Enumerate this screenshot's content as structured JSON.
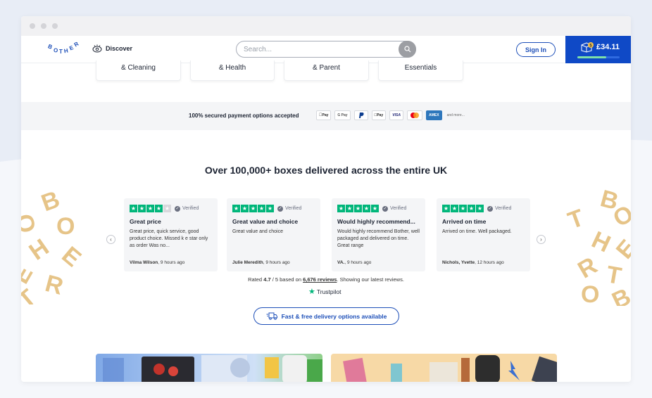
{
  "header": {
    "logo_text": "BOTHER",
    "discover_label": "Discover",
    "search_placeholder": "Search...",
    "signin_label": "Sign In",
    "cart_amount": "£34.11",
    "cart_badge": "5",
    "cart_progress": 0.68
  },
  "categories": [
    {
      "label": "& Cleaning"
    },
    {
      "label": "& Health"
    },
    {
      "label": "& Parent"
    },
    {
      "label": "Essentials"
    }
  ],
  "payments": {
    "text": "100% secured payment options accepted",
    "methods": [
      "Pay",
      "G Pay",
      "PayPal",
      "Pay",
      "VISA",
      "",
      "AMEX"
    ],
    "more": "and more..."
  },
  "headline": "Over 100,000+ boxes delivered across the entire UK",
  "reviews": [
    {
      "stars": 4,
      "verified": "Verified",
      "title": "Great price",
      "body": "Great price, quick service, good product choice. Missed k e star only as order Was no...",
      "author": "Vilma Wilson",
      "time": ", 9 hours ago"
    },
    {
      "stars": 5,
      "verified": "Verified",
      "title": "Great value and choice",
      "body": "Great value and choice",
      "author": "Julie Meredith",
      "time": ", 9 hours ago"
    },
    {
      "stars": 5,
      "verified": "Verified",
      "title": "Would highly recommend...",
      "body": "Would highly recommend Bother, well packaged and delivered on time. Great range",
      "author": "VA.",
      "time": ", 9 hours ago"
    },
    {
      "stars": 5,
      "verified": "Verified",
      "title": "Arrived on time",
      "body": "Arrived on time. Well packaged.",
      "author": "Nichols, Yvette",
      "time": ", 12 hours ago"
    }
  ],
  "rating": {
    "prefix": "Rated ",
    "score": "4.7",
    "middle": " / 5 based on ",
    "count": "6,676 reviews",
    "suffix": ". Showing our latest reviews.",
    "brand": "Trustpilot"
  },
  "delivery_label": "Fast & free delivery options available",
  "colors": {
    "brand_blue": "#0f49c6",
    "trustpilot_green": "#00b67a",
    "accent_gold": "#e6c488"
  }
}
